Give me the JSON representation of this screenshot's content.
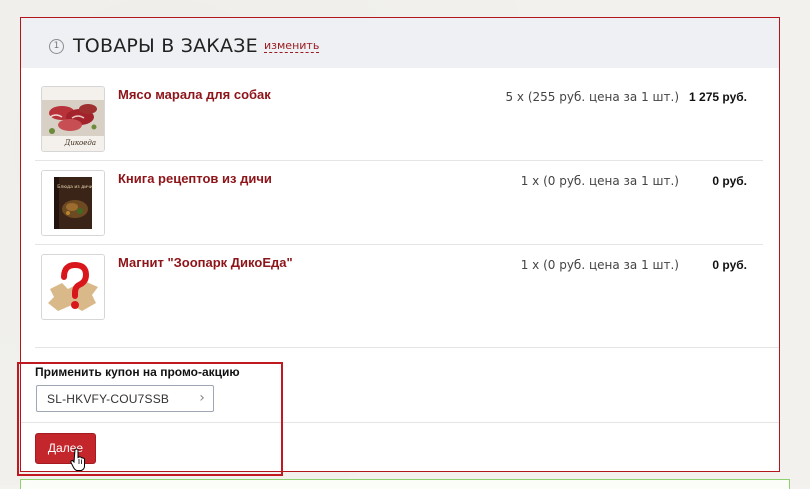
{
  "section": {
    "step_number": "1",
    "title": "ТОВАРЫ В ЗАКАЗЕ",
    "edit_link": "изменить"
  },
  "items": [
    {
      "name": "Мясо марала для собак",
      "quantity_price": "5 x (255 руб. цена за 1 шт.)",
      "total": "1 275 руб.",
      "thumb_icon": "meat-product-image",
      "thumb_caption": "Дикоеда"
    },
    {
      "name": "Книга рецептов из дичи",
      "quantity_price": "1 x (0 руб. цена за 1 шт.)",
      "total": "0 руб.",
      "thumb_icon": "recipe-book-image",
      "thumb_caption": "Блюда из дичи"
    },
    {
      "name": "Магнит \"Зоопарк ДикоЕда\"",
      "quantity_price": "1 x (0 руб. цена за 1 шт.)",
      "total": "0 руб.",
      "thumb_icon": "missing-image-placeholder"
    }
  ],
  "coupon": {
    "label": "Применить купон на промо-акцию",
    "value": "SL-HKVFY-COU7SSB",
    "submit_icon": "chevron-right-icon"
  },
  "actions": {
    "next_label": "Далее"
  },
  "colors": {
    "accent": "#c3262b",
    "link": "#8d1419",
    "header_bg": "#eef0f3",
    "next_section_border": "#8fd170"
  }
}
